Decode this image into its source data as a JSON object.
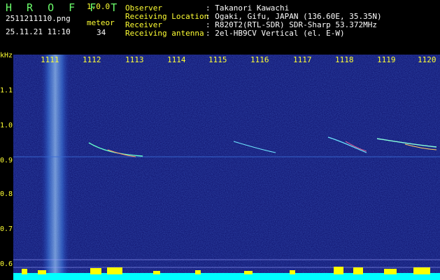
{
  "header": {
    "brand": "H R O F F T",
    "version": "1.0.0",
    "filename": "2511211110.png",
    "datetime": "25.11.21 11:10",
    "meteor_label": "meteor",
    "meteor_count": "34",
    "fields": [
      {
        "label": "Observer",
        "value": ": Takanori Kawachi"
      },
      {
        "label": "Receiving Location",
        "value": ": Ogaki, Gifu, JAPAN (136.60E, 35.35N)"
      },
      {
        "label": "Receiver",
        "value": ": R820T2(RTL-SDR) SDR-Sharp 53.372MHz"
      },
      {
        "label": "Receiving antenna",
        "value": ": 2el-HB9CV Vertical (el. E-W)"
      }
    ]
  },
  "axes": {
    "y_unit": "kHz",
    "y_ticks": [
      "1.1",
      "1.0",
      "0.9",
      "0.8",
      "0.7",
      "0.6"
    ],
    "x_ticks": [
      "1111",
      "1112",
      "1113",
      "1114",
      "1115",
      "1116",
      "1117",
      "1118",
      "1119",
      "1120"
    ]
  },
  "colors": {
    "background": "#0a0a64",
    "text_yellow": "#ffff33",
    "text_white": "#ffffff",
    "brand_green": "#6cff6c",
    "noise_band": "#ffff00",
    "baseline": "#00ffff"
  }
}
